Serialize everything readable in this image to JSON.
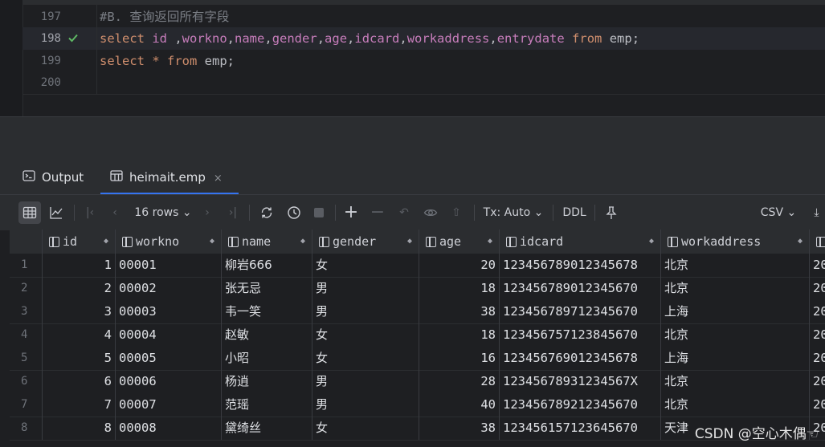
{
  "editor": {
    "lines": [
      {
        "num": "197",
        "tokens": [
          {
            "t": "#B. 查询返回所有字段",
            "c": "cmt"
          }
        ]
      },
      {
        "num": "198",
        "check": true,
        "tokens": [
          {
            "t": "select ",
            "c": "kw"
          },
          {
            "t": "id ",
            "c": "col"
          },
          {
            "t": ",",
            "c": "op"
          },
          {
            "t": "workno",
            "c": "col"
          },
          {
            "t": ",",
            "c": "op"
          },
          {
            "t": "name",
            "c": "col"
          },
          {
            "t": ",",
            "c": "op"
          },
          {
            "t": "gender",
            "c": "col"
          },
          {
            "t": ",",
            "c": "op"
          },
          {
            "t": "age",
            "c": "col"
          },
          {
            "t": ",",
            "c": "op"
          },
          {
            "t": "idcard",
            "c": "col"
          },
          {
            "t": ",",
            "c": "op"
          },
          {
            "t": "workaddress",
            "c": "col"
          },
          {
            "t": ",",
            "c": "op"
          },
          {
            "t": "entrydate ",
            "c": "col"
          },
          {
            "t": "from ",
            "c": "kw"
          },
          {
            "t": "emp;",
            "c": "id"
          }
        ]
      },
      {
        "num": "199",
        "tokens": [
          {
            "t": "select ",
            "c": "kw"
          },
          {
            "t": "* ",
            "c": "kw"
          },
          {
            "t": "from ",
            "c": "kw"
          },
          {
            "t": "emp;",
            "c": "id"
          }
        ]
      },
      {
        "num": "200",
        "tokens": []
      }
    ]
  },
  "tabs": {
    "output_label": "Output",
    "result_label": "heimait.emp",
    "close_glyph": "×"
  },
  "toolbar": {
    "rows_label": "16 rows",
    "tx_label": "Tx: Auto",
    "ddl_label": "DDL",
    "csv_label": "CSV"
  },
  "grid": {
    "columns": [
      "id",
      "workno",
      "name",
      "gender",
      "age",
      "idcard",
      "workaddress",
      ""
    ],
    "rows": [
      {
        "n": "1",
        "id": "1",
        "workno": "00001",
        "name": "柳岩666",
        "gender": "女",
        "age": "20",
        "idcard": "123456789012345678",
        "workaddress": "北京",
        "entry": "20"
      },
      {
        "n": "2",
        "id": "2",
        "workno": "00002",
        "name": "张无忌",
        "gender": "男",
        "age": "18",
        "idcard": "123456789012345670",
        "workaddress": "北京",
        "entry": "20"
      },
      {
        "n": "3",
        "id": "3",
        "workno": "00003",
        "name": "韦一笑",
        "gender": "男",
        "age": "38",
        "idcard": "123456789712345670",
        "workaddress": "上海",
        "entry": "20"
      },
      {
        "n": "4",
        "id": "4",
        "workno": "00004",
        "name": "赵敏",
        "gender": "女",
        "age": "18",
        "idcard": "123456757123845670",
        "workaddress": "北京",
        "entry": "20"
      },
      {
        "n": "5",
        "id": "5",
        "workno": "00005",
        "name": "小昭",
        "gender": "女",
        "age": "16",
        "idcard": "123456769012345678",
        "workaddress": "上海",
        "entry": "20"
      },
      {
        "n": "6",
        "id": "6",
        "workno": "00006",
        "name": "杨逍",
        "gender": "男",
        "age": "28",
        "idcard": "12345678931234567X",
        "workaddress": "北京",
        "entry": "20"
      },
      {
        "n": "7",
        "id": "7",
        "workno": "00007",
        "name": "范瑶",
        "gender": "男",
        "age": "40",
        "idcard": "123456789212345670",
        "workaddress": "北京",
        "entry": "20"
      },
      {
        "n": "8",
        "id": "8",
        "workno": "00008",
        "name": "黛绮丝",
        "gender": "女",
        "age": "38",
        "idcard": "123456157123645670",
        "workaddress": "天津",
        "entry": "20"
      }
    ]
  },
  "watermark": "CSDN @空心木偶☜",
  "colors": {
    "accent": "#3574f0",
    "keyword": "#cf8e6d",
    "column": "#c77dbb",
    "comment": "#7a7e85",
    "check": "#5fb865"
  }
}
